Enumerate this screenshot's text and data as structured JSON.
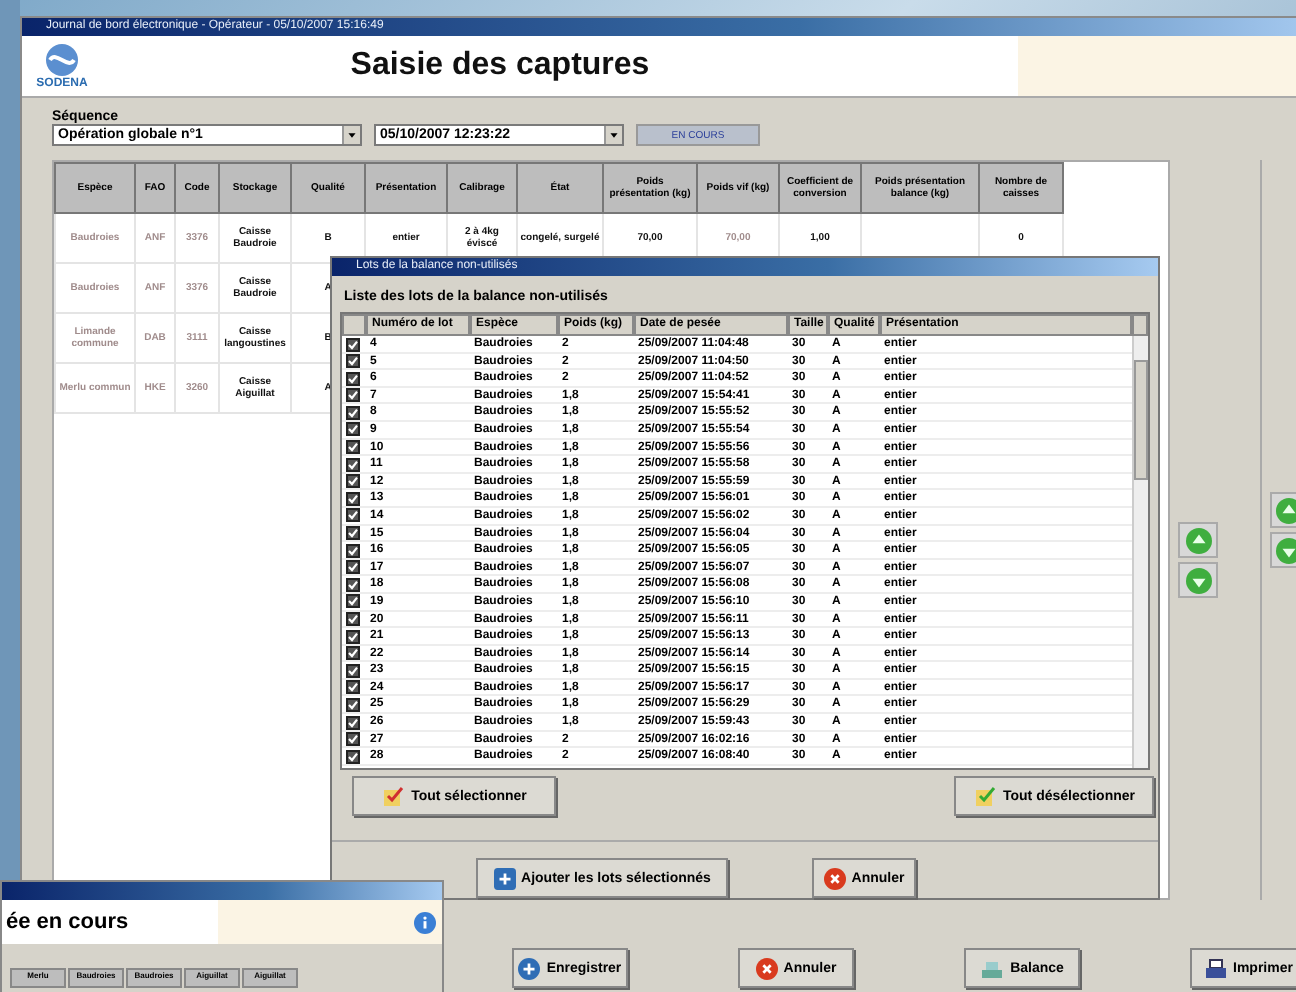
{
  "window": {
    "title": "Journal de bord électronique - Opérateur - 05/10/2007 15:16:49",
    "logo_text": "SODENA",
    "heading": "Saisie des captures"
  },
  "sequence": {
    "label": "Séquence",
    "operation": "Opération globale n°1",
    "date": "05/10/2007 12:23:22",
    "status": "EN COURS"
  },
  "captures": {
    "columns": [
      "Espèce",
      "FAO",
      "Code",
      "Stockage",
      "Qualité",
      "Présentation",
      "Calibrage",
      "État",
      "Poids présentation (kg)",
      "Poids vif (kg)",
      "Coefficient de conversion",
      "Poids présentation balance (kg)",
      "Nombre de caisses"
    ],
    "rows": [
      [
        "Baudroies",
        "ANF",
        "3376",
        "Caisse Baudroie",
        "B",
        "entier",
        "2 à 4kg éviscé",
        "congelé, surgelé",
        "70,00",
        "70,00",
        "1,00",
        "",
        "0"
      ],
      [
        "Baudroies",
        "ANF",
        "3376",
        "Caisse Baudroie",
        "A",
        "",
        "",
        "",
        "",
        "",
        "",
        "",
        ""
      ],
      [
        "Limande commune",
        "DAB",
        "3111",
        "Caisse langoustines",
        "B",
        "",
        "",
        "",
        "",
        "",
        "",
        "",
        ""
      ],
      [
        "Merlu commun",
        "HKE",
        "3260",
        "Caisse Aiguillat",
        "A",
        "",
        "",
        "",
        "",
        "",
        "",
        "",
        ""
      ]
    ]
  },
  "dialog": {
    "title": "Lots de la balance non-utilisés",
    "heading": "Liste des lots de la balance non-utilisés",
    "columns": [
      "Numéro de lot",
      "Espèce",
      "Poids (kg)",
      "Date de pesée",
      "Taille",
      "Qualité",
      "Présentation"
    ],
    "rows": [
      {
        "checked": true,
        "cells": [
          "4",
          "Baudroies",
          "2",
          "25/09/2007 11:04:48",
          "30",
          "A",
          "entier"
        ]
      },
      {
        "checked": true,
        "cells": [
          "5",
          "Baudroies",
          "2",
          "25/09/2007 11:04:50",
          "30",
          "A",
          "entier"
        ]
      },
      {
        "checked": true,
        "cells": [
          "6",
          "Baudroies",
          "2",
          "25/09/2007 11:04:52",
          "30",
          "A",
          "entier"
        ]
      },
      {
        "checked": true,
        "cells": [
          "7",
          "Baudroies",
          "1,8",
          "25/09/2007 15:54:41",
          "30",
          "A",
          "entier"
        ]
      },
      {
        "checked": true,
        "cells": [
          "8",
          "Baudroies",
          "1,8",
          "25/09/2007 15:55:52",
          "30",
          "A",
          "entier"
        ]
      },
      {
        "checked": true,
        "cells": [
          "9",
          "Baudroies",
          "1,8",
          "25/09/2007 15:55:54",
          "30",
          "A",
          "entier"
        ]
      },
      {
        "checked": true,
        "cells": [
          "10",
          "Baudroies",
          "1,8",
          "25/09/2007 15:55:56",
          "30",
          "A",
          "entier"
        ]
      },
      {
        "checked": true,
        "cells": [
          "11",
          "Baudroies",
          "1,8",
          "25/09/2007 15:55:58",
          "30",
          "A",
          "entier"
        ]
      },
      {
        "checked": true,
        "cells": [
          "12",
          "Baudroies",
          "1,8",
          "25/09/2007 15:55:59",
          "30",
          "A",
          "entier"
        ]
      },
      {
        "checked": true,
        "cells": [
          "13",
          "Baudroies",
          "1,8",
          "25/09/2007 15:56:01",
          "30",
          "A",
          "entier"
        ]
      },
      {
        "checked": true,
        "cells": [
          "14",
          "Baudroies",
          "1,8",
          "25/09/2007 15:56:02",
          "30",
          "A",
          "entier"
        ]
      },
      {
        "checked": true,
        "cells": [
          "15",
          "Baudroies",
          "1,8",
          "25/09/2007 15:56:04",
          "30",
          "A",
          "entier"
        ]
      },
      {
        "checked": true,
        "cells": [
          "16",
          "Baudroies",
          "1,8",
          "25/09/2007 15:56:05",
          "30",
          "A",
          "entier"
        ]
      },
      {
        "checked": true,
        "cells": [
          "17",
          "Baudroies",
          "1,8",
          "25/09/2007 15:56:07",
          "30",
          "A",
          "entier"
        ]
      },
      {
        "checked": true,
        "cells": [
          "18",
          "Baudroies",
          "1,8",
          "25/09/2007 15:56:08",
          "30",
          "A",
          "entier"
        ]
      },
      {
        "checked": true,
        "cells": [
          "19",
          "Baudroies",
          "1,8",
          "25/09/2007 15:56:10",
          "30",
          "A",
          "entier"
        ]
      },
      {
        "checked": true,
        "cells": [
          "20",
          "Baudroies",
          "1,8",
          "25/09/2007 15:56:11",
          "30",
          "A",
          "entier"
        ]
      },
      {
        "checked": true,
        "cells": [
          "21",
          "Baudroies",
          "1,8",
          "25/09/2007 15:56:13",
          "30",
          "A",
          "entier"
        ]
      },
      {
        "checked": true,
        "cells": [
          "22",
          "Baudroies",
          "1,8",
          "25/09/2007 15:56:14",
          "30",
          "A",
          "entier"
        ]
      },
      {
        "checked": true,
        "cells": [
          "23",
          "Baudroies",
          "1,8",
          "25/09/2007 15:56:15",
          "30",
          "A",
          "entier"
        ]
      },
      {
        "checked": true,
        "cells": [
          "24",
          "Baudroies",
          "1,8",
          "25/09/2007 15:56:17",
          "30",
          "A",
          "entier"
        ]
      },
      {
        "checked": true,
        "cells": [
          "25",
          "Baudroies",
          "1,8",
          "25/09/2007 15:56:29",
          "30",
          "A",
          "entier"
        ]
      },
      {
        "checked": true,
        "cells": [
          "26",
          "Baudroies",
          "1,8",
          "25/09/2007 15:59:43",
          "30",
          "A",
          "entier"
        ]
      },
      {
        "checked": true,
        "cells": [
          "27",
          "Baudroies",
          "2",
          "25/09/2007 16:02:16",
          "30",
          "A",
          "entier"
        ]
      },
      {
        "checked": true,
        "cells": [
          "28",
          "Baudroies",
          "2",
          "25/09/2007 16:08:40",
          "30",
          "A",
          "entier"
        ]
      }
    ],
    "select_all": "Tout sélectionner",
    "deselect_all": "Tout désélectionner",
    "add": "Ajouter les lots sélectionnés",
    "cancel": "Annuler"
  },
  "buttons": [
    {
      "kind": "save",
      "label": "Enregistrer"
    },
    {
      "kind": "cancel",
      "label": "Annuler"
    },
    {
      "kind": "scale",
      "label": "Balance"
    },
    {
      "kind": "print",
      "label": "Imprimer"
    }
  ],
  "back_window": {
    "heading": "ée en cours",
    "tabs": [
      "Merlu",
      "Baudroies",
      "Baudroies",
      "Aiguillat",
      "Aiguillat"
    ]
  }
}
